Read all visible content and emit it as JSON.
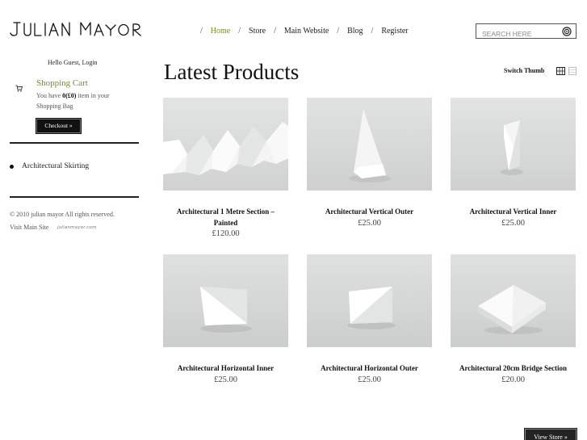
{
  "brand": {
    "logo_text": "JULIAN MAYOR"
  },
  "nav": {
    "items": [
      {
        "label": "Home",
        "active": true
      },
      {
        "label": "Store"
      },
      {
        "label": "Main Website"
      },
      {
        "label": "Blog"
      },
      {
        "label": "Register"
      }
    ],
    "separator": "/"
  },
  "search": {
    "placeholder": "SEARCH HERE",
    "icon": "target-icon"
  },
  "sidebar": {
    "greeting": "Hello Guest, Login",
    "cart": {
      "title": "Shopping Cart",
      "text_prefix": "You have ",
      "count": "0(£0)",
      "text_suffix": " item in your Shopping Bag",
      "checkout_label": "Checkout »"
    },
    "categories": [
      "Architectural Skirting"
    ],
    "copyright": "© 2010 julian mayor All rights reserved.",
    "visit_label": "Visit Main Site",
    "visit_link": "julianmayor.com"
  },
  "main": {
    "heading": "Latest Products",
    "switch_label": "Switch Thumb",
    "products": [
      {
        "name": "Architectural 1 Metre Section – Painted",
        "price": "£120.00"
      },
      {
        "name": "Architectural Vertical Outer",
        "price": "£25.00"
      },
      {
        "name": "Architectural Vertical Inner",
        "price": "£25.00"
      },
      {
        "name": "Architectural Horizontal Inner",
        "price": "£25.00"
      },
      {
        "name": "Architectural Horizontal Outer",
        "price": "£25.00"
      },
      {
        "name": "Architectural 20cm Bridge Section",
        "price": "£20.00"
      }
    ],
    "view_store_label": "View Store »"
  },
  "colors": {
    "accent": "#7b8a2a",
    "text": "#222222",
    "button_bg": "#111111"
  }
}
